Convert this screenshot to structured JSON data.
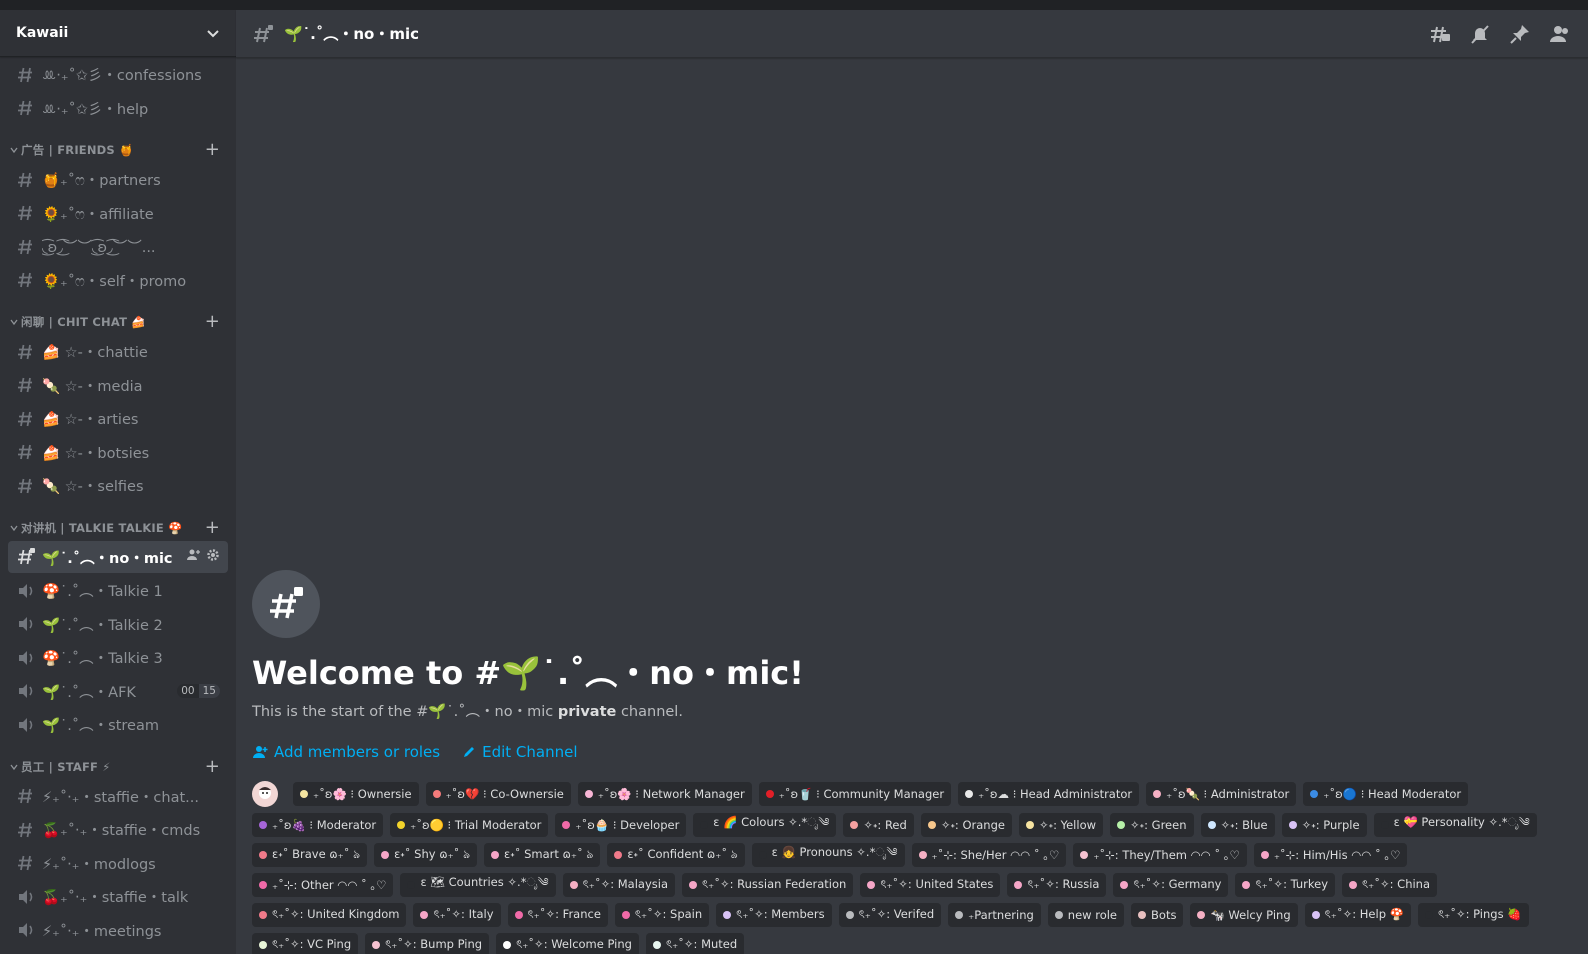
{
  "server": {
    "name": "Kawaii"
  },
  "sidebar": {
    "top_channels": [
      {
        "name": "ꔛ‧₊˚✩彡・confessions",
        "type": "text"
      },
      {
        "name": "ꔛ‧₊˚✩彡・help",
        "type": "text"
      }
    ],
    "categories": [
      {
        "name": "广告 | FRIENDS 🍯",
        "channels": [
          {
            "name": "🍯₊˚ෆ・partners",
            "type": "text"
          },
          {
            "name": "🌻₊˚ෆ・affiliate",
            "type": "text"
          },
          {
            "name": "◟͜͡ʚ◞͜͡︶︶◟͜͡ʚ◞͜͡︶︶...",
            "type": "text"
          },
          {
            "name": "🌻₊˚ෆ・self・promo",
            "type": "text"
          }
        ]
      },
      {
        "name": "闲聊 | CHIT CHAT 🍰",
        "channels": [
          {
            "name": "🍰 ☆-・chattie",
            "type": "text"
          },
          {
            "name": "🍡 ☆-・media",
            "type": "text"
          },
          {
            "name": "🍰 ☆-・arties",
            "type": "text"
          },
          {
            "name": "🍰 ☆-・botsies",
            "type": "text"
          },
          {
            "name": "🍡 ☆-・selfies",
            "type": "text"
          }
        ]
      },
      {
        "name": "对讲机 | TALKIE TALKIE 🍄",
        "channels": [
          {
            "name": "🌱˙.˚︵・no・mic",
            "type": "text",
            "active": true
          },
          {
            "name": "🍄˙.˚︵・Talkie 1",
            "type": "voice"
          },
          {
            "name": "🌱˙.˚︵・Talkie 2",
            "type": "voice"
          },
          {
            "name": "🍄˙.˚︵・Talkie 3",
            "type": "voice"
          },
          {
            "name": "🌱˙.˚︵・AFK",
            "type": "voice",
            "count_a": "00",
            "count_b": "15"
          },
          {
            "name": "🌱˙.˚︵・stream",
            "type": "voice"
          }
        ]
      },
      {
        "name": "员工 | STAFF ⚡",
        "channels": [
          {
            "name": "⚡₊˚‧₊・staffie・chat...",
            "type": "text"
          },
          {
            "name": "🍒₊˚‧₊・staffie・cmds",
            "type": "text"
          },
          {
            "name": "⚡₊˚‧₊・modlogs",
            "type": "text"
          },
          {
            "name": "🍒₊˚‧₊・staffie・talk",
            "type": "voice"
          },
          {
            "name": "⚡₊˚‧₊・meetings",
            "type": "voice"
          }
        ]
      }
    ]
  },
  "main": {
    "channel_title": "🌱˙.˚︵・no・mic",
    "welcome_title": "Welcome to #🌱˙.˚︵・no・mic!",
    "welcome_sub_prefix": "This is the start of the #🌱˙.˚︵・no・mic ",
    "welcome_sub_bold": "private",
    "welcome_sub_suffix": " channel.",
    "add_members": "Add members or roles",
    "edit_channel": "Edit Channel"
  },
  "roles": [
    {
      "label": "₊˚ʚ🌸 ⁝ Ownersie",
      "color": "#f4e4a1"
    },
    {
      "label": "₊˚ʚ💔 ⁝ Co-Ownersie",
      "color": "#f47b7b"
    },
    {
      "label": "₊˚ʚ🌸 ⁝ Network Manager",
      "color": "#f7b5d5"
    },
    {
      "label": "₊˚ʚ🥤 ⁝ Community Manager",
      "color": "#e21f28"
    },
    {
      "label": "₊˚ʚ☁ ⁝ Head Administrator",
      "color": "#e8e8e8"
    },
    {
      "label": "₊˚ʚ🍡 ⁝ Administrator",
      "color": "#f5b0c4"
    },
    {
      "label": "₊˚ʚ🔵 ⁝ Head Moderator",
      "color": "#3b8ce5"
    },
    {
      "label": "₊˚ʚ🍇 ⁝ Moderator",
      "color": "#a565d8"
    },
    {
      "label": "₊˚ʚ🟡 ⁝ Trial Moderator",
      "color": "#f2d32b"
    },
    {
      "label": "₊˚ʚ🧁 ⁝ Developer",
      "color": "#f06aa8"
    },
    {
      "label": "ɛ 🌈 Colours ✧.*ೃ༄",
      "color": "#292b2f"
    },
    {
      "label": "✧˖: Red",
      "color": "#f4a0a0"
    },
    {
      "label": "✧˖: Orange",
      "color": "#f7c78c"
    },
    {
      "label": "✧˖: Yellow",
      "color": "#f6e3a1"
    },
    {
      "label": "✧˖: Green",
      "color": "#b6f0a8"
    },
    {
      "label": "✧˖: Blue",
      "color": "#cfe7ff"
    },
    {
      "label": "✧˖: Purple",
      "color": "#d8c2f5"
    },
    {
      "label": "ɛ 💝 Personality ✧.*ೃ༄",
      "color": "#292b2f"
    },
    {
      "label": "ɛ˖˚ Brave ɷ₊˚ ঌ",
      "color": "#f07a8a"
    },
    {
      "label": "ɛ˖˚ Shy ɷ₊˚ ঌ",
      "color": "#f5a6c7"
    },
    {
      "label": "ɛ˖˚ Smart ɷ₊˚ ঌ",
      "color": "#f5a6c7"
    },
    {
      "label": "ɛ˖˚ Confident ɷ₊˚ ঌ",
      "color": "#f07a8a"
    },
    {
      "label": "ɛ 👧 Pronouns ✧.*ೃ༄",
      "color": "#292b2f"
    },
    {
      "label": "₊˚⊹: She/Her ◠◠ ˚ ｡♡",
      "color": "#f5b0c4"
    },
    {
      "label": "₊˚⊹: They/Them ◠◠ ˚ ｡♡",
      "color": "#f5c2d1"
    },
    {
      "label": "₊˚⊹: Him/His ◠◠ ˚ ｡♡",
      "color": "#f5a6c7"
    },
    {
      "label": "₊˚⊹: Other ◠◠ ˚ ｡♡",
      "color": "#f06aa8"
    },
    {
      "label": "ɛ 🗺 Countries ✧.*ೃ༄",
      "color": "#292b2f"
    },
    {
      "label": "ৎ₊˚✧: Malaysia",
      "color": "#f5b0c4"
    },
    {
      "label": "ৎ₊˚✧: Russian Federation",
      "color": "#f5a6c7"
    },
    {
      "label": "ৎ₊˚✧: United States",
      "color": "#f5a6c7"
    },
    {
      "label": "ৎ₊˚✧: Russia",
      "color": "#f5a6c7"
    },
    {
      "label": "ৎ₊˚✧: Germany",
      "color": "#f5a6c7"
    },
    {
      "label": "ৎ₊˚✧: Turkey",
      "color": "#f5a6c7"
    },
    {
      "label": "ৎ₊˚✧: China",
      "color": "#f5a6c7"
    },
    {
      "label": "ৎ₊˚✧: United Kingdom",
      "color": "#f07a8a"
    },
    {
      "label": "ৎ₊˚✧: Italy",
      "color": "#f5a6c7"
    },
    {
      "label": "ৎ₊˚✧: France",
      "color": "#f06aa8"
    },
    {
      "label": "ৎ₊˚✧: Spain",
      "color": "#f06aa8"
    },
    {
      "label": "ৎ₊˚✧: Members",
      "color": "#d8c2f5"
    },
    {
      "label": "ৎ₊˚✧: Verifed",
      "color": "#b9bbbe"
    },
    {
      "label": "₊Partnering",
      "color": "#b9bbbe"
    },
    {
      "label": "new role",
      "color": "#b9bbbe"
    },
    {
      "label": "Bots",
      "color": "#e8c0c0"
    },
    {
      "label": "🐄 Welcy Ping",
      "color": "#f5b0c4"
    },
    {
      "label": "ৎ₊˚✧: Help 🍄",
      "color": "#d8c2f5"
    },
    {
      "label": "ৎ₊˚✧: Pings 🍓",
      "color": "#292b2f"
    },
    {
      "label": "ৎ₊˚✧: VC Ping",
      "color": "#e8f5d8"
    },
    {
      "label": "ৎ₊˚✧: Bump Ping",
      "color": "#f5c2d1"
    },
    {
      "label": "ৎ₊˚✧: Welcome Ping",
      "color": "#ffffff"
    },
    {
      "label": "ৎ₊˚✧: Muted",
      "color": "#e8f5f0"
    }
  ]
}
